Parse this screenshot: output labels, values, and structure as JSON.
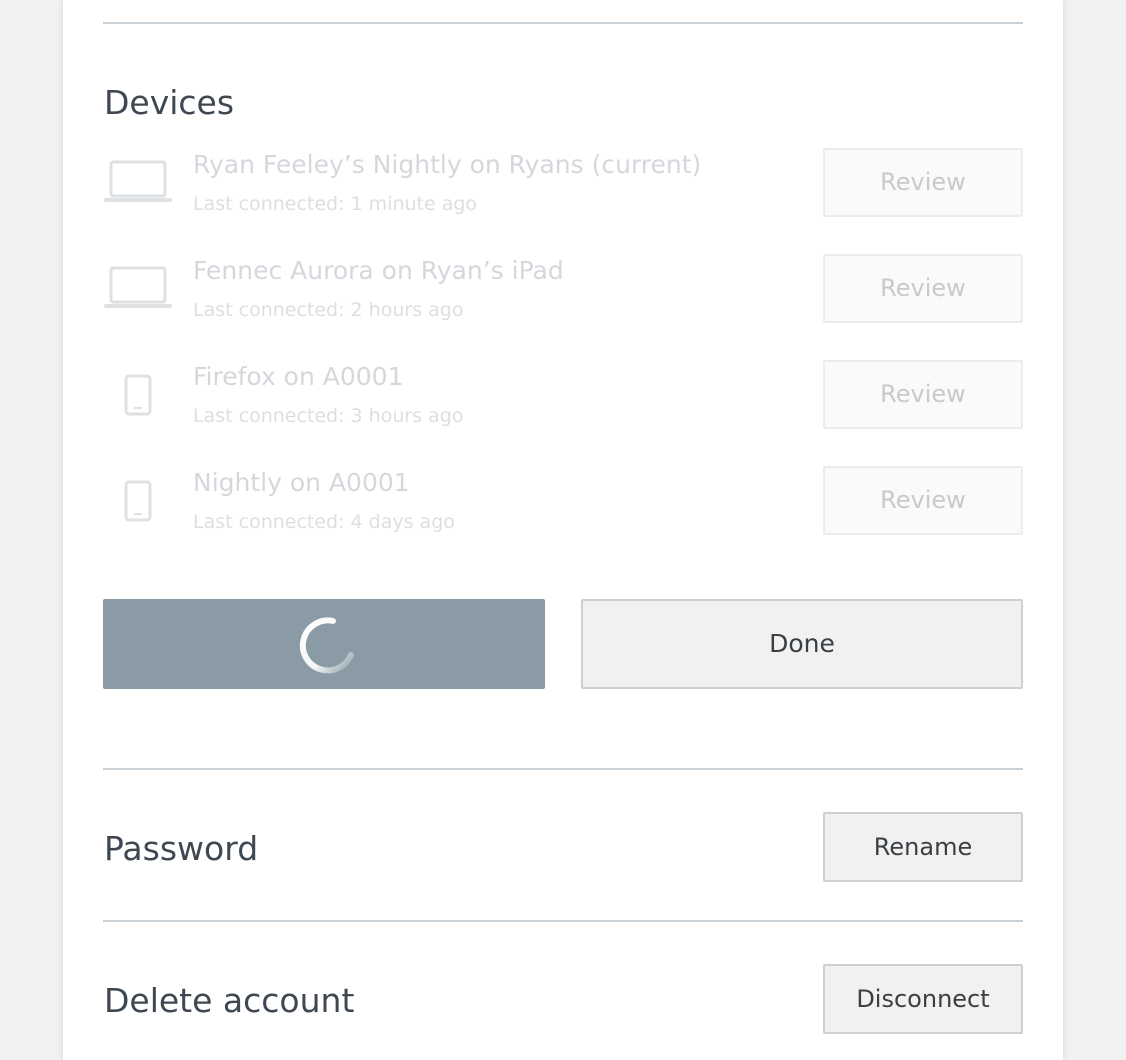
{
  "devices_section": {
    "title": "Devices",
    "items": [
      {
        "name": "Ryan Feeley’s Nightly on Ryans (current)",
        "last_connected": "Last connected: 1 minute ago",
        "type": "laptop",
        "action_label": "Review"
      },
      {
        "name": "Fennec Aurora on Ryan’s iPad",
        "last_connected": "Last connected: 2 hours ago",
        "type": "laptop",
        "action_label": "Review"
      },
      {
        "name": "Firefox on A0001",
        "last_connected": "Last connected: 3 hours ago",
        "type": "phone",
        "action_label": "Review"
      },
      {
        "name": "Nightly on A0001",
        "last_connected": "Last connected: 4 days ago",
        "type": "phone",
        "action_label": "Review"
      }
    ],
    "done_label": "Done"
  },
  "password_section": {
    "title": "Password",
    "action_label": "Rename"
  },
  "delete_section": {
    "title": "Delete account",
    "action_label": "Disconnect"
  },
  "icons": {
    "laptop": "laptop-icon",
    "phone": "phone-icon",
    "spinner": "loading-spinner-icon"
  },
  "colors": {
    "primary_button": "#8a9ba5",
    "title_text": "#3f4852",
    "muted_text": "#d4d8dc"
  }
}
